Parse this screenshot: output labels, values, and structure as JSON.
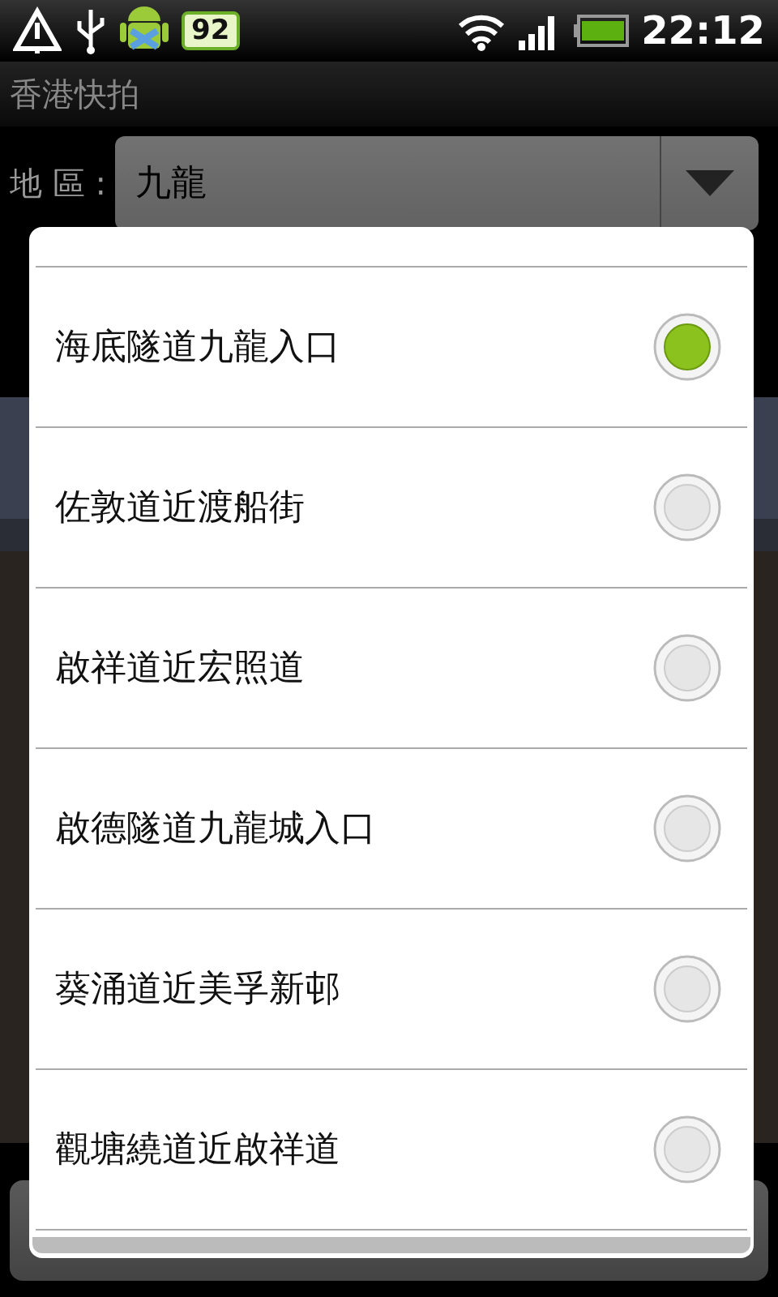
{
  "status_bar": {
    "battery_badge": "92",
    "time": "22:12"
  },
  "app_title": "香港快拍",
  "region": {
    "label": "地 區 :",
    "value": "九龍"
  },
  "dialog": {
    "options": [
      {
        "label": "海底隧道九龍入口",
        "selected": true
      },
      {
        "label": "佐敦道近渡船街",
        "selected": false
      },
      {
        "label": "啟祥道近宏照道",
        "selected": false
      },
      {
        "label": "啟德隧道九龍城入口",
        "selected": false
      },
      {
        "label": "葵涌道近美孚新邨",
        "selected": false
      },
      {
        "label": "觀塘繞道近啟祥道",
        "selected": false
      }
    ]
  }
}
